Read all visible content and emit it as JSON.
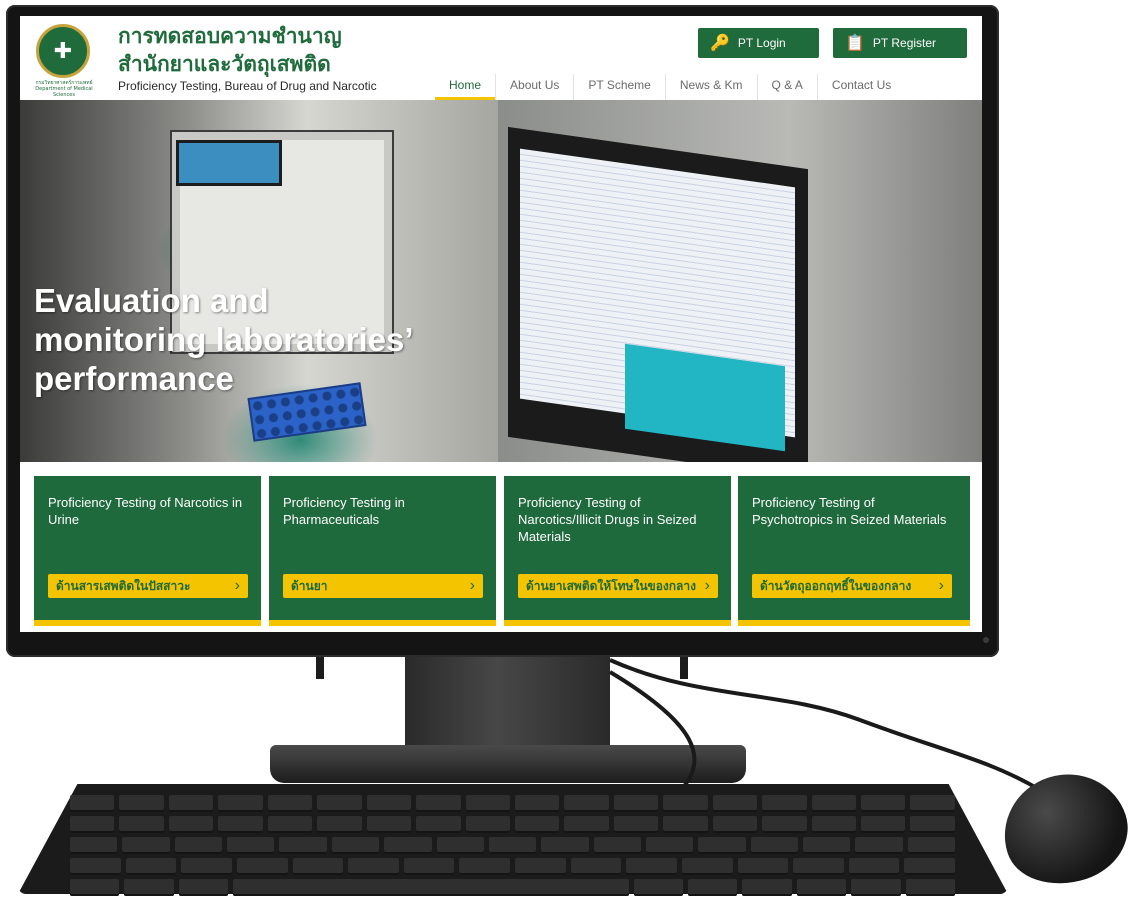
{
  "site": {
    "title_th_line1": "การทดสอบความชำนาญ",
    "title_th_line2": "สำนักยาและวัตถุเสพติด",
    "title_en": "Proficiency Testing, Bureau of Drug and Narcotic",
    "logo_caption": "กรมวิทยาศาสตร์การแพทย์ Department of Medical Sciences"
  },
  "top_buttons": {
    "login_label": "PT Login",
    "register_label": "PT Register"
  },
  "nav": {
    "items": [
      {
        "label": "Home",
        "active": true
      },
      {
        "label": "About Us"
      },
      {
        "label": "PT Scheme"
      },
      {
        "label": "News & Km"
      },
      {
        "label": "Q & A"
      },
      {
        "label": "Contact Us"
      }
    ]
  },
  "hero": {
    "line1": "Evaluation and",
    "line2": "monitoring laboratories’",
    "line3": "performance"
  },
  "cards": [
    {
      "title": "Proficiency Testing of Narcotics in Urine",
      "button": "ด้านสารเสพติดในปัสสาวะ"
    },
    {
      "title": "Proficiency Testing in Pharmaceuticals",
      "button": "ด้านยา"
    },
    {
      "title": "Proficiency Testing of Narcotics/Illicit Drugs in Seized Materials",
      "button": "ด้านยาเสพติดให้โทษในของกลาง"
    },
    {
      "title": "Proficiency Testing of Psychotropics in Seized Materials",
      "button": "ด้านวัตถุออกฤทธิ์ในของกลาง"
    }
  ],
  "colors": {
    "brand_green": "#1f6b3c",
    "accent_yellow": "#f5c400"
  }
}
